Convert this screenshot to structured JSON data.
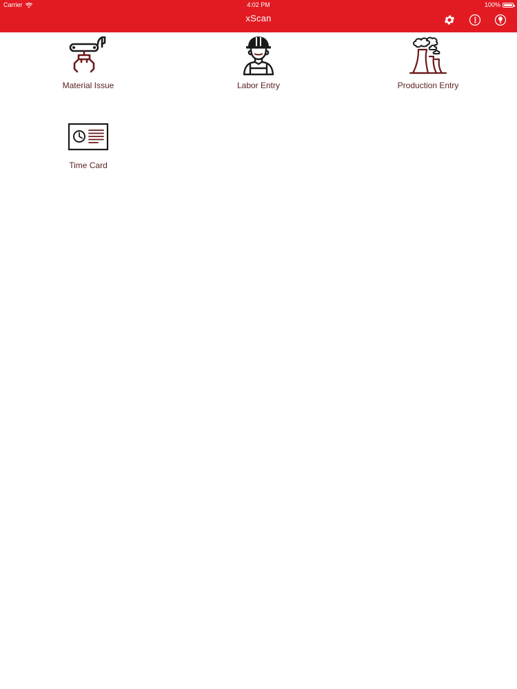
{
  "status_bar": {
    "carrier": "Carrier",
    "time": "4:02 PM",
    "battery": "100%"
  },
  "nav": {
    "title": "xScan",
    "icons": [
      "gear-icon",
      "info-icon",
      "lightbulb-icon"
    ]
  },
  "tiles": [
    {
      "label": "Material Issue",
      "icon": "robotic-claw-icon"
    },
    {
      "label": "Labor Entry",
      "icon": "worker-hardhat-icon"
    },
    {
      "label": "Production Entry",
      "icon": "factory-smokestack-icon"
    },
    {
      "label": "Time Card",
      "icon": "time-card-icon"
    }
  ],
  "colors": {
    "brand_red": "#e21b22",
    "label_text": "#5a1e1e",
    "icon_dark": "#1a1a1a",
    "icon_accent": "#6b1a1a"
  }
}
